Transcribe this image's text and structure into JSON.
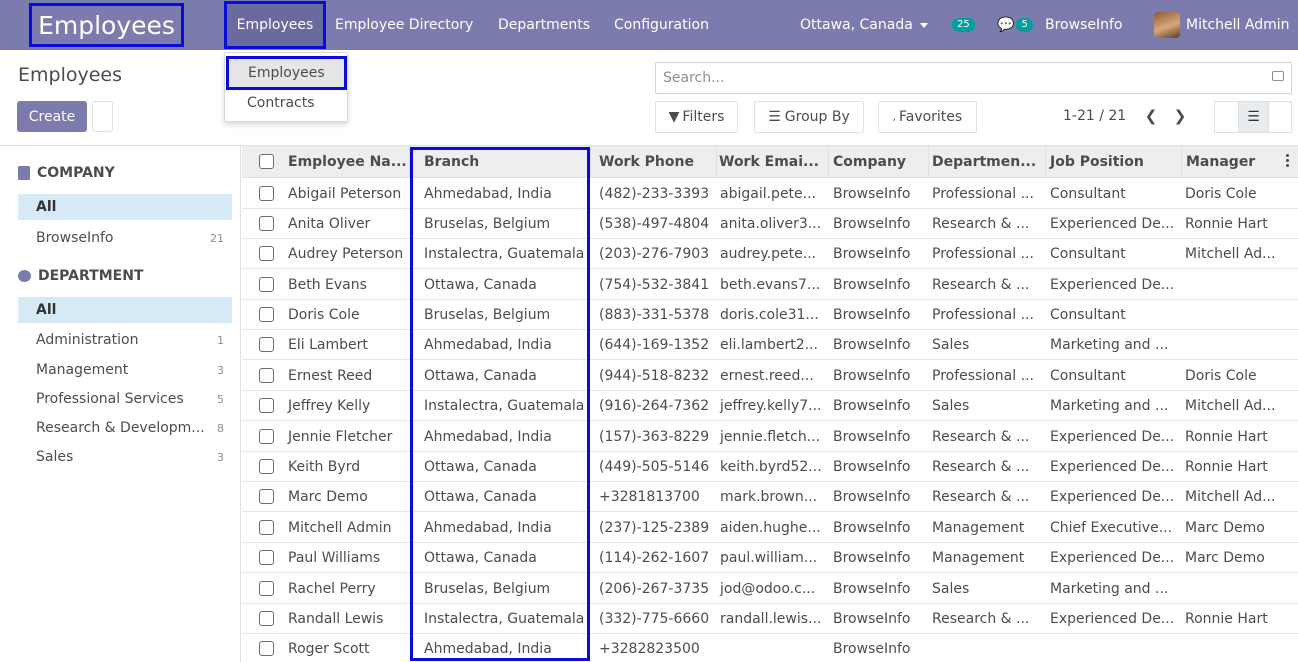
{
  "navbar": {
    "app_title": "Employees",
    "menu": [
      "Employees",
      "Employee Directory",
      "Departments",
      "Configuration"
    ],
    "company": "Ottawa, Canada",
    "activity_count": "25",
    "messages_count": "5",
    "company_label": "BrowseInfo",
    "user": "Mitchell Admin"
  },
  "dropdown": {
    "items": [
      "Employees",
      "Contracts"
    ]
  },
  "control_panel": {
    "breadcrumb": "Employees",
    "create_label": "Create",
    "search_placeholder": "Search...",
    "filters_label": "Filters",
    "groupby_label": "Group By",
    "favorites_label": "Favorites",
    "pager": "1-21 / 21"
  },
  "sidebar": {
    "company_header": "COMPANY",
    "company_items": [
      {
        "label": "All",
        "count": ""
      },
      {
        "label": "BrowseInfo",
        "count": "21"
      }
    ],
    "department_header": "DEPARTMENT",
    "department_items": [
      {
        "label": "All",
        "count": ""
      },
      {
        "label": "Administration",
        "count": "1"
      },
      {
        "label": "Management",
        "count": "3"
      },
      {
        "label": "Professional Services",
        "count": "5"
      },
      {
        "label": "Research & Developm...",
        "count": "8"
      },
      {
        "label": "Sales",
        "count": "3"
      }
    ]
  },
  "table": {
    "columns": [
      "Employee Na...",
      "Branch",
      "Work Phone",
      "Work Emai...",
      "Company",
      "Departmen...",
      "Job Position",
      "Manager"
    ],
    "rows": [
      [
        "Abigail Peterson",
        "Ahmedabad, India",
        "(482)-233-3393",
        "abigail.pete...",
        "BrowseInfo",
        "Professional ...",
        "Consultant",
        "Doris Cole"
      ],
      [
        "Anita Oliver",
        "Bruselas, Belgium",
        "(538)-497-4804",
        "anita.oliver3...",
        "BrowseInfo",
        "Research & ...",
        "Experienced De...",
        "Ronnie Hart"
      ],
      [
        "Audrey Peterson",
        "Instalectra, Guatemala",
        "(203)-276-7903",
        "audrey.pete...",
        "BrowseInfo",
        "Professional ...",
        "Consultant",
        "Mitchell Ad..."
      ],
      [
        "Beth Evans",
        "Ottawa, Canada",
        "(754)-532-3841",
        "beth.evans7...",
        "BrowseInfo",
        "Research & ...",
        "Experienced De...",
        ""
      ],
      [
        "Doris Cole",
        "Bruselas, Belgium",
        "(883)-331-5378",
        "doris.cole31...",
        "BrowseInfo",
        "Professional ...",
        "Consultant",
        ""
      ],
      [
        "Eli Lambert",
        "Ahmedabad, India",
        "(644)-169-1352",
        "eli.lambert2...",
        "BrowseInfo",
        "Sales",
        "Marketing and ...",
        ""
      ],
      [
        "Ernest Reed",
        "Ottawa, Canada",
        "(944)-518-8232",
        "ernest.reed...",
        "BrowseInfo",
        "Professional ...",
        "Consultant",
        "Doris Cole"
      ],
      [
        "Jeffrey Kelly",
        "Instalectra, Guatemala",
        "(916)-264-7362",
        "jeffrey.kelly7...",
        "BrowseInfo",
        "Sales",
        "Marketing and ...",
        "Mitchell Ad..."
      ],
      [
        "Jennie Fletcher",
        "Ahmedabad, India",
        "(157)-363-8229",
        "jennie.fletch...",
        "BrowseInfo",
        "Research & ...",
        "Experienced De...",
        "Ronnie Hart"
      ],
      [
        "Keith Byrd",
        "Ottawa, Canada",
        "(449)-505-5146",
        "keith.byrd52...",
        "BrowseInfo",
        "Research & ...",
        "Experienced De...",
        "Ronnie Hart"
      ],
      [
        "Marc Demo",
        "Ottawa, Canada",
        "+3281813700",
        "mark.brown...",
        "BrowseInfo",
        "Research & ...",
        "Experienced De...",
        "Mitchell Ad..."
      ],
      [
        "Mitchell Admin",
        "Ahmedabad, India",
        "(237)-125-2389",
        "aiden.hughe...",
        "BrowseInfo",
        "Management",
        "Chief Executive...",
        "Marc Demo"
      ],
      [
        "Paul Williams",
        "Ottawa, Canada",
        "(114)-262-1607",
        "paul.william...",
        "BrowseInfo",
        "Management",
        "Experienced De...",
        "Marc Demo"
      ],
      [
        "Rachel Perry",
        "Bruselas, Belgium",
        "(206)-267-3735",
        "jod@odoo.c...",
        "BrowseInfo",
        "Sales",
        "Marketing and ...",
        ""
      ],
      [
        "Randall Lewis",
        "Instalectra, Guatemala",
        "(332)-775-6660",
        "randall.lewis...",
        "BrowseInfo",
        "Research & ...",
        "Experienced De...",
        "Ronnie Hart"
      ],
      [
        "Roger Scott",
        "Ahmedabad, India",
        "+3282823500",
        "",
        "BrowseInfo",
        "",
        "",
        ""
      ]
    ]
  },
  "colors": {
    "brand": "#7c7bad",
    "highlight_border": "#0a0adb",
    "active_filter": "#d6eaf6",
    "badge": "#00a09d"
  }
}
